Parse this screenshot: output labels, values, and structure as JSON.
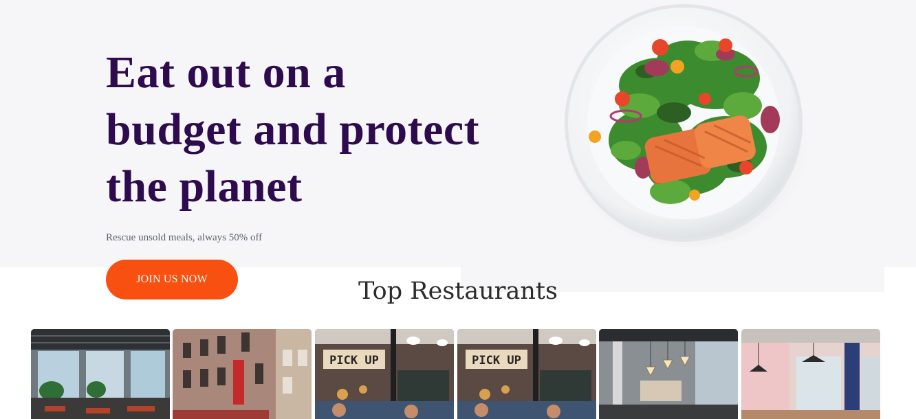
{
  "hero": {
    "headline": "Eat out on a budget and protect the planet",
    "subtext": "Rescue unsold meals, always 50% off",
    "cta_label": "JOIN US NOW",
    "plate_image": "salmon-salad-plate-image"
  },
  "restaurants_section": {
    "title": "Top Restaurants",
    "cards": [
      {
        "image": "restaurant-interior-windows-image"
      },
      {
        "image": "brick-building-storefront-image"
      },
      {
        "image": "pick-up-counter-image",
        "sign_text": "PICK UP"
      },
      {
        "image": "pick-up-counter-image",
        "sign_text": "PICK UP"
      },
      {
        "image": "restaurant-pendant-lights-image"
      },
      {
        "image": "restaurant-pink-wall-image"
      }
    ]
  },
  "colors": {
    "headline": "#2d0b4e",
    "accent": "#f85010",
    "hero_background": "#f6f5f7"
  }
}
